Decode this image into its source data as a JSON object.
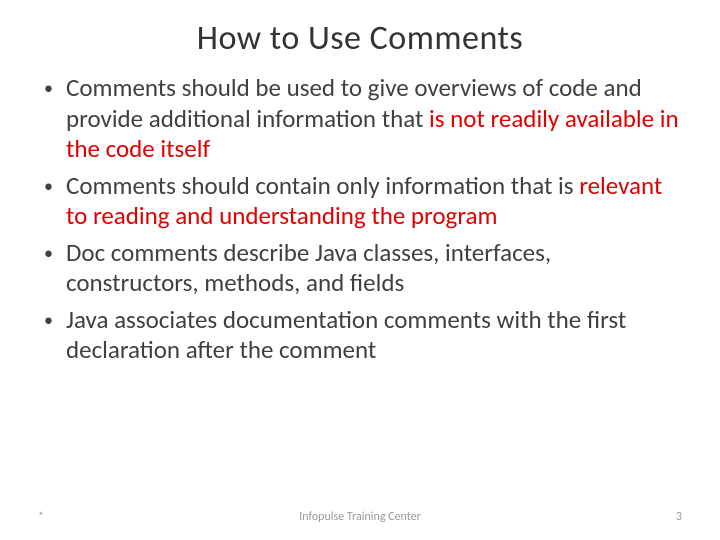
{
  "title": "How to Use Comments",
  "bullets": [
    {
      "plain1": "Comments should be used to give overviews of code and provide additional information that ",
      "highlight": "is not readily available in the code itself",
      "plain2": ""
    },
    {
      "plain1": " Comments should contain only information that is ",
      "highlight": "relevant to reading and understanding the program",
      "plain2": ""
    },
    {
      "plain1": "Doc comments describe Java classes, interfaces, constructors, methods, and fields",
      "highlight": "",
      "plain2": ""
    },
    {
      "plain1": "Java associates documentation comments with the first declaration after the comment",
      "highlight": "",
      "plain2": ""
    }
  ],
  "footer": {
    "left": "*",
    "center": "Infopulse Training Center",
    "right": "3"
  }
}
